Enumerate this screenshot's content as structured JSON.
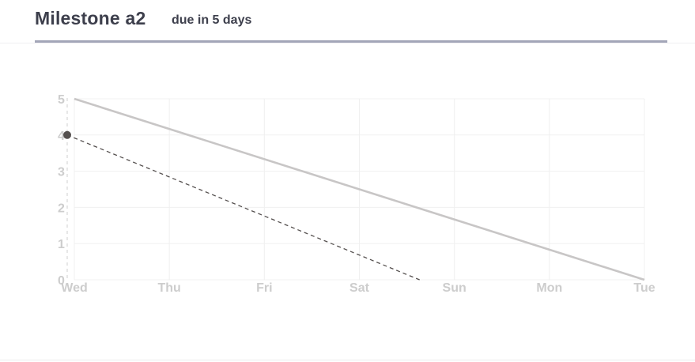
{
  "header": {
    "title": "Milestone a2",
    "due": "due in 5 days"
  },
  "colors": {
    "title_text": "#3d3f4c",
    "accent_line": "#a3a6b8",
    "ideal_line": "#c8c6c6",
    "actual_line": "#55504f",
    "marker": "#55504f",
    "grid": "#f0f0f0",
    "tick_label": "#cdcdcd"
  },
  "chart_data": {
    "type": "line",
    "title": "",
    "xlabel": "",
    "ylabel": "",
    "categories": [
      "Wed",
      "Thu",
      "Fri",
      "Sat",
      "Sun",
      "Mon",
      "Tue"
    ],
    "yticks": [
      0,
      1,
      2,
      3,
      4,
      5
    ],
    "ylim": [
      0,
      5
    ],
    "grid": true,
    "legend": "none",
    "series": [
      {
        "style": "solid",
        "points": [
          {
            "x": "Wed",
            "y": 5
          },
          {
            "x": "Tue",
            "y": 0
          }
        ]
      },
      {
        "style": "dashed",
        "points": [
          {
            "x": "Wed",
            "y": 4
          },
          {
            "x": "Sun",
            "y": 0
          }
        ]
      }
    ],
    "markers": [
      {
        "x": "Wed",
        "y": 4
      }
    ]
  }
}
